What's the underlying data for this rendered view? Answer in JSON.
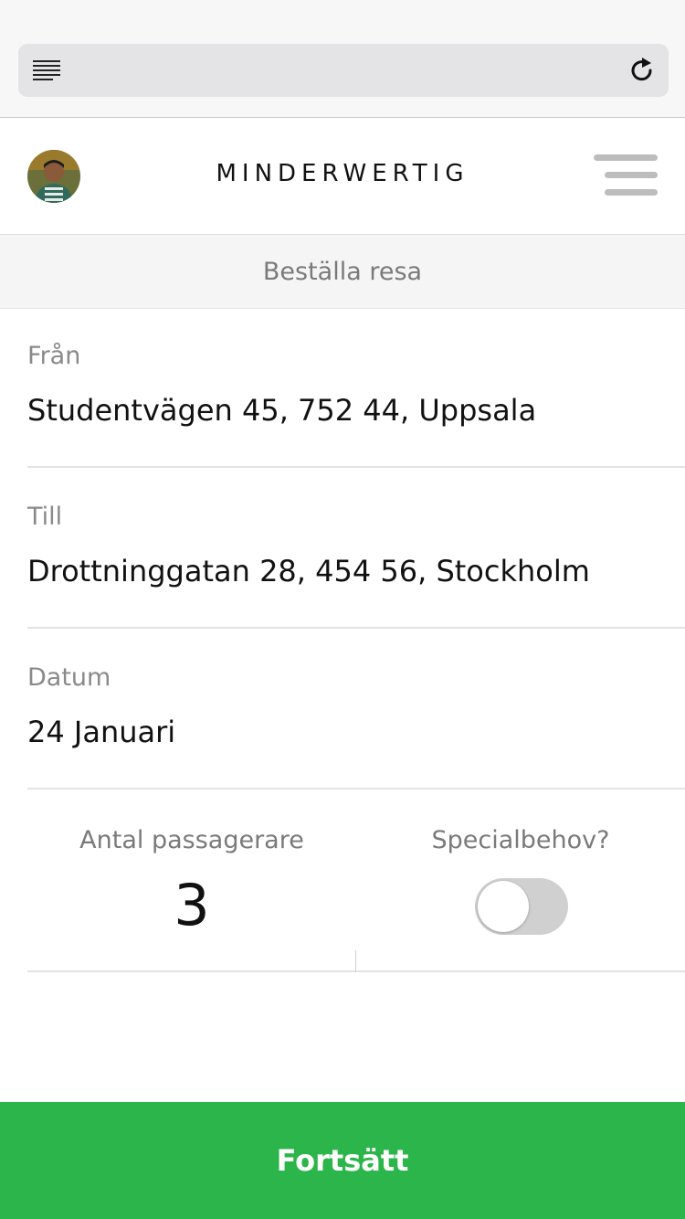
{
  "browser": {
    "reader_icon": "reader-view-icon",
    "reload_icon": "reload-icon"
  },
  "header": {
    "brand": "MINDERWERTIG",
    "avatar": "user-avatar",
    "menu_icon": "hamburger-menu-icon"
  },
  "subheader": {
    "title": "Beställa resa"
  },
  "form": {
    "from": {
      "label": "Från",
      "value": "Studentvägen 45, 752 44, Uppsala"
    },
    "to": {
      "label": "Till",
      "value": "Drottninggatan 28, 454 56, Stockholm"
    },
    "date": {
      "label": "Datum",
      "value": "24 Januari"
    },
    "passengers": {
      "label": "Antal passagerare",
      "value": "3"
    },
    "special_needs": {
      "label": "Specialbehov?",
      "enabled": false
    }
  },
  "cta": {
    "label": "Fortsätt",
    "color": "#2cb54a"
  }
}
